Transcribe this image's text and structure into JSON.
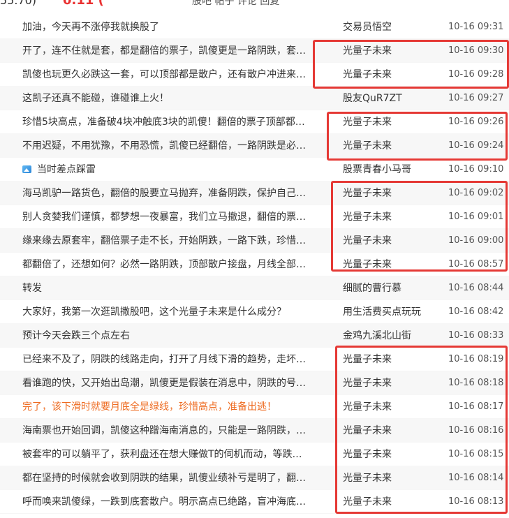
{
  "header_fragment": {
    "left_text": "55.70)",
    "red_text": "0.11 (",
    "middle_text": "股吧 帖子 评论 回复"
  },
  "highlight_color": "#e53935",
  "posts": [
    {
      "title": "加油，今天再不涨停我就换股了",
      "author": "交易员悟空",
      "time": "10-16 09:31"
    },
    {
      "title": "开了，连不住就是套，都是翻倍的票子，凯傻更是一路阴跌，套…",
      "author": "光量子未来",
      "time": "10-16 09:30"
    },
    {
      "title": "凯傻也玩更久必跌这一套，可以顶部都是散户，还有散户冲进来…",
      "author": "光量子未来",
      "time": "10-16 09:28"
    },
    {
      "title": "这凯子还真不能碰，谁碰谁上火！",
      "author": "股友QuR7ZT",
      "time": "10-16 09:27"
    },
    {
      "title": "珍惜5块高点，准备破4块冲触底3块的凯傻！翻倍的票子顶部都…",
      "author": "光量子未来",
      "time": "10-16 09:26"
    },
    {
      "title": "不用迟疑，不用犹豫，不用恐慌，凯傻已经翻倍，一路阴跌是必…",
      "author": "光量子未来",
      "time": "10-16 09:24"
    },
    {
      "title": "当时差点踩雷",
      "author": "股票青春小马哥",
      "time": "10-16 09:10",
      "icon": "image-icon"
    },
    {
      "title": "海马凯驴一路货色，翻倍的股要立马抛弃，准备阴跌，保护自己…",
      "author": "光量子未来",
      "time": "10-16 09:02"
    },
    {
      "title": "别人贪婪我们谨慎，都梦想一夜暴富，我们立马撤退，翻倍的票…",
      "author": "光量子未来",
      "time": "10-16 09:01"
    },
    {
      "title": "缘来缘去原套牢，翻倍票子走不长，开始阴跌，一路下跌，珍惜…",
      "author": "光量子未来",
      "time": "10-16 09:00"
    },
    {
      "title": "都翻倍了，还想如何？必然一路阴跌，顶部散户接盘，月线全部…",
      "author": "光量子未来",
      "time": "10-16 08:57"
    },
    {
      "title": "转发",
      "author": "细腻的曹行慕",
      "time": "10-16 08:44"
    },
    {
      "title": "大家好，我第一次逛凯撒股吧，这个光量子未来是什么成分？",
      "author": "用生活费买点玩玩",
      "time": "10-16 08:42"
    },
    {
      "title": "预计今天会跌三个点左右",
      "author": "金鸡九溪北山街",
      "time": "10-16 08:33"
    },
    {
      "title": "已经来不及了，阴跌的线路走向，打开了月线下滑的趋势，走坏…",
      "author": "光量子未来",
      "time": "10-16 08:19"
    },
    {
      "title": "看谁跑的快，又开始出岛潮，凯傻更是假装在消息中，阴跌的号…",
      "author": "光量子未来",
      "time": "10-16 08:18"
    },
    {
      "title": "完了，该下滑时就要月底全是绿线，珍惜高点，准备出逃！",
      "author": "光量子未来",
      "time": "10-16 08:17",
      "highlight": true
    },
    {
      "title": "海南票也开始回调，凯傻这种蹭海南消息的，只能是一路阴跌，…",
      "author": "光量子未来",
      "time": "10-16 08:16"
    },
    {
      "title": "被套牢的可以躺平了，获利盘还在想大赚做T的伺机而动，等跌…",
      "author": "光量子未来",
      "time": "10-16 08:15"
    },
    {
      "title": "都在坚持的时候就会收到阴跌的结果，凯傻业绩补亏是明了，翻…",
      "author": "光量子未来",
      "time": "10-16 08:14"
    },
    {
      "title": "呼而唤来凯傻绿，一跌到底套散户。明示高点已绝路，盲冲海底…",
      "author": "光量子未来",
      "time": "10-16 08:13"
    }
  ]
}
